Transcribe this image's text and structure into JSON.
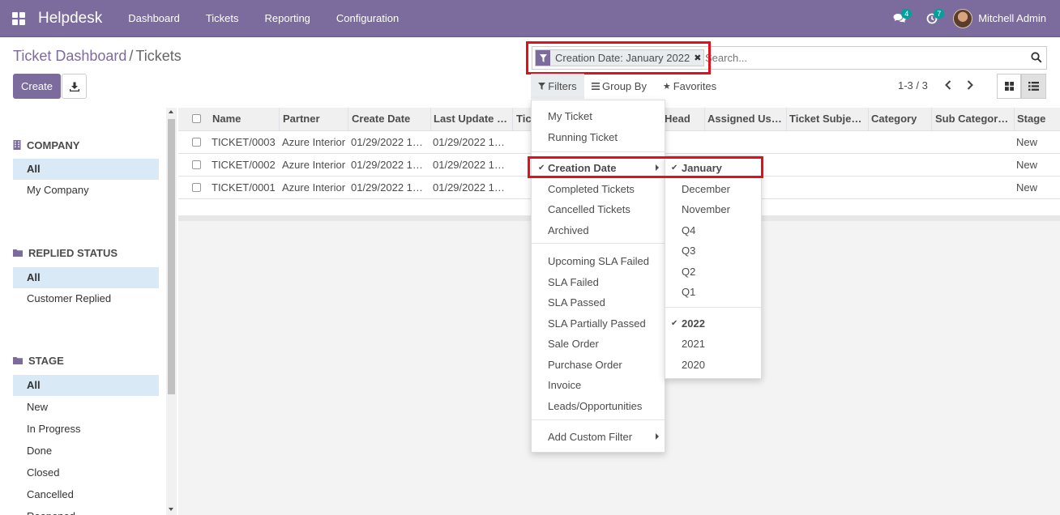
{
  "navbar": {
    "brand": "Helpdesk",
    "menu": [
      "Dashboard",
      "Tickets",
      "Reporting",
      "Configuration"
    ],
    "messages_badge": "4",
    "activities_badge": "7",
    "user_name": "Mitchell Admin",
    "bg_color": "#7c6b9d"
  },
  "breadcrumb": {
    "parent": "Ticket Dashboard",
    "separator": "/",
    "current": "Tickets"
  },
  "buttons": {
    "create": "Create",
    "download_icon": "download-icon"
  },
  "search": {
    "facet_icon": "filter-icon",
    "facet_label": "Creation Date: January 2022",
    "placeholder": "Search..."
  },
  "filter_buttons": {
    "filters": "Filters",
    "group_by": "Group By",
    "favorites": "Favorites"
  },
  "pager": {
    "text": "1-3 / 3"
  },
  "sidebar": {
    "sections": [
      {
        "title": "COMPANY",
        "icon": "building-icon",
        "items": [
          "All",
          "My Company"
        ],
        "active": "All"
      },
      {
        "title": "REPLIED STATUS",
        "icon": "folder-icon",
        "items": [
          "All",
          "Customer Replied"
        ],
        "active": "All"
      },
      {
        "title": "STAGE",
        "icon": "folder-icon",
        "items": [
          "All",
          "New",
          "In Progress",
          "Done",
          "Closed",
          "Cancelled",
          "Reopened"
        ],
        "active": "All"
      }
    ]
  },
  "table": {
    "columns": [
      "Name",
      "Partner",
      "Create Date",
      "Last Update …",
      "Tic",
      "Head",
      "Assigned Us…",
      "Ticket Subje…",
      "Category",
      "Sub Categor…",
      "Stage"
    ],
    "rows": [
      {
        "name": "TICKET/0003",
        "partner": "Azure Interior",
        "create_date": "01/29/2022 1…",
        "last_update": "01/29/2022 1…",
        "stage": "New"
      },
      {
        "name": "TICKET/0002",
        "partner": "Azure Interior",
        "create_date": "01/29/2022 1…",
        "last_update": "01/29/2022 1…",
        "stage": "New"
      },
      {
        "name": "TICKET/0001",
        "partner": "Azure Interior",
        "create_date": "01/29/2022 1…",
        "last_update": "01/29/2022 1…",
        "stage": "New"
      }
    ]
  },
  "filters_menu": {
    "group1": [
      "My Ticket",
      "Running Ticket"
    ],
    "creation_date": "Creation Date",
    "group2": [
      "Completed Tickets",
      "Cancelled Tickets",
      "Archived"
    ],
    "group3": [
      "Upcoming SLA Failed",
      "SLA Failed",
      "SLA Passed",
      "SLA Partially Passed",
      "Sale Order",
      "Purchase Order",
      "Invoice",
      "Leads/Opportunities"
    ],
    "custom": "Add Custom Filter"
  },
  "date_submenu": {
    "months": [
      "January",
      "December",
      "November",
      "Q4",
      "Q3",
      "Q2",
      "Q1"
    ],
    "years": [
      "2022",
      "2021",
      "2020"
    ],
    "selected_month": "January",
    "selected_year": "2022"
  },
  "colors": {
    "accent": "#7c6b9d",
    "highlight": "#e0101c",
    "active_row": "#d9eaf6"
  }
}
